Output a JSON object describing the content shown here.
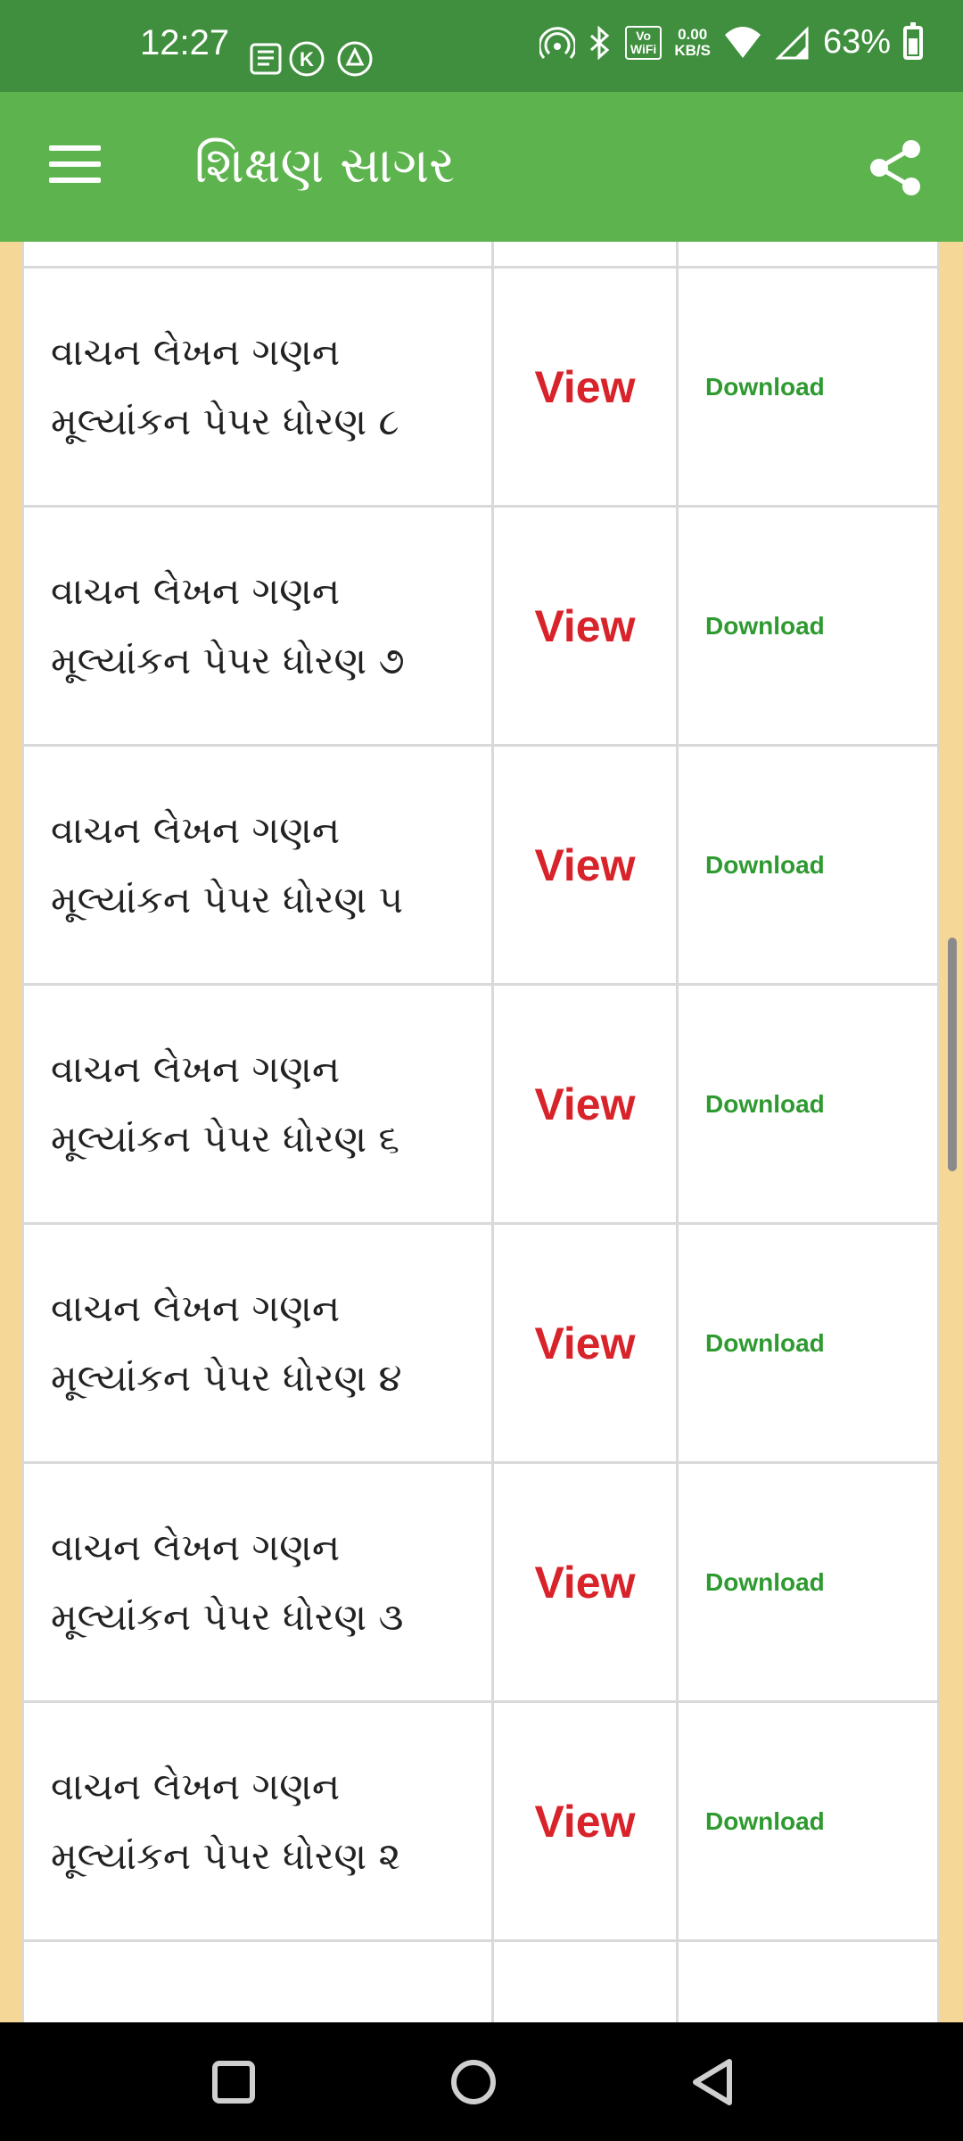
{
  "status_bar": {
    "time": "12:27",
    "netspeed_value": "0.00",
    "netspeed_unit": "KB/S",
    "battery": "63%",
    "icons": [
      "news-icon",
      "k-app-icon",
      "drive-icon",
      "hotspot-icon",
      "bluetooth-icon",
      "vowifi-icon",
      "wifi-icon",
      "signal-icon",
      "battery-icon"
    ],
    "vowifi_label_top": "Vo",
    "vowifi_label_bottom": "WiFi"
  },
  "app_bar": {
    "title": "શિક્ષણ સાગર",
    "menu_icon": "hamburger-menu-icon",
    "share_icon": "share-icon"
  },
  "table": {
    "rows": [
      {
        "title": "વાચન લેખન ગણન\nમૂલ્યાંકન પેપર ધોરણ ૮",
        "view": "View",
        "download": "Download"
      },
      {
        "title": "વાચન લેખન ગણન\nમૂલ્યાંકન પેપર ધોરણ ૭",
        "view": "View",
        "download": "Download"
      },
      {
        "title": "વાચન લેખન ગણન\nમૂલ્યાંકન પેપર ધોરણ ૫",
        "view": "View",
        "download": "Download"
      },
      {
        "title": "વાચન લેખન ગણન\nમૂલ્યાંકન પેપર ધોરણ ૬",
        "view": "View",
        "download": "Download"
      },
      {
        "title": "વાચન લેખન ગણન\nમૂલ્યાંકન પેપર ધોરણ ૪",
        "view": "View",
        "download": "Download"
      },
      {
        "title": "વાચન લેખન ગણન\nમૂલ્યાંકન પેપર ધોરણ ૩",
        "view": "View",
        "download": "Download"
      },
      {
        "title": "વાચન લેખન ગણન\nમૂલ્યાંકન પેપર ધોરણ ૨",
        "view": "View",
        "download": "Download"
      }
    ]
  },
  "colors": {
    "status_bar": "#3f8f3e",
    "app_bar": "#5db44e",
    "view": "#d8232a",
    "download": "#2e9a30",
    "page_edge": "#f5d898"
  },
  "nav_bar": {
    "icons": [
      "recents-square-icon",
      "home-circle-icon",
      "back-triangle-icon"
    ]
  }
}
